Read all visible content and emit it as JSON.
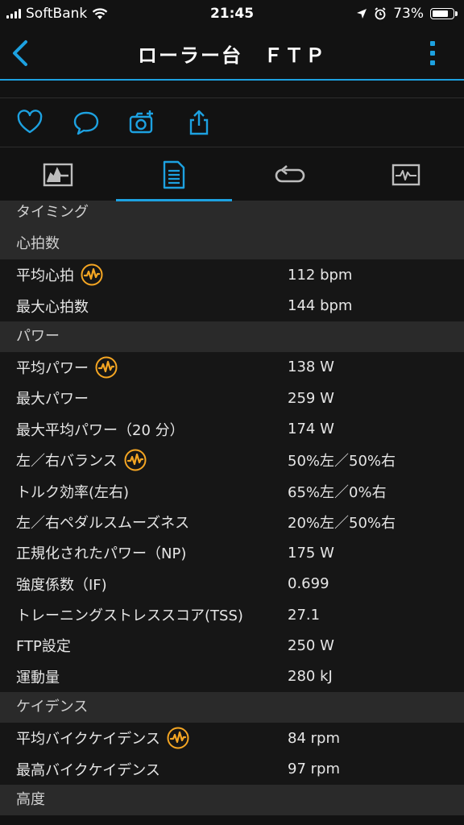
{
  "status": {
    "carrier": "SoftBank",
    "time": "21:45",
    "battery": "73%"
  },
  "nav": {
    "title": "ローラー台　ＦＴＰ",
    "back_icon": "chevron-left-icon",
    "more_icon": "more-vertical-icon"
  },
  "actions": [
    "heart-icon",
    "comment-icon",
    "camera-add-icon",
    "share-icon"
  ],
  "tabs": [
    {
      "icon": "chart-tab-icon",
      "active": false
    },
    {
      "icon": "details-tab-icon",
      "active": true
    },
    {
      "icon": "laps-tab-icon",
      "active": false
    },
    {
      "icon": "graphs-tab-icon",
      "active": false
    }
  ],
  "sections": {
    "timing": {
      "title": "タイミング"
    },
    "heart": {
      "title": "心拍数",
      "rows": [
        {
          "label": "平均心拍",
          "value": "112 bpm",
          "badge": true
        },
        {
          "label": "最大心拍数",
          "value": "144 bpm",
          "badge": false
        }
      ]
    },
    "power": {
      "title": "パワー",
      "rows": [
        {
          "label": "平均パワー",
          "value": "138 W",
          "badge": true
        },
        {
          "label": "最大パワー",
          "value": "259 W",
          "badge": false
        },
        {
          "label": "最大平均パワー（20 分）",
          "value": "174 W",
          "badge": false
        },
        {
          "label": "左／右バランス",
          "value": "50%左／50%右",
          "badge": true
        },
        {
          "label": "トルク効率(左右)",
          "value": "65%左／0%右",
          "badge": false
        },
        {
          "label": "左／右ペダルスムーズネス",
          "value": "20%左／50%右",
          "badge": false
        },
        {
          "label": "正規化されたパワー（NP)",
          "value": "175 W",
          "badge": false
        },
        {
          "label": "強度係数（IF)",
          "value": "0.699",
          "badge": false
        },
        {
          "label": "トレーニングストレススコア(TSS)",
          "value": "27.1",
          "badge": false
        },
        {
          "label": "FTP設定",
          "value": "250 W",
          "badge": false
        },
        {
          "label": "運動量",
          "value": "280 kJ",
          "badge": false
        }
      ]
    },
    "cadence": {
      "title": "ケイデンス",
      "rows": [
        {
          "label": "平均バイクケイデンス",
          "value": "84 rpm",
          "badge": true
        },
        {
          "label": "最高バイクケイデンス",
          "value": "97 rpm",
          "badge": false
        }
      ]
    },
    "altitude": {
      "title": "高度"
    }
  },
  "colors": {
    "accent": "#1da1e0",
    "badge": "#f5a623"
  }
}
